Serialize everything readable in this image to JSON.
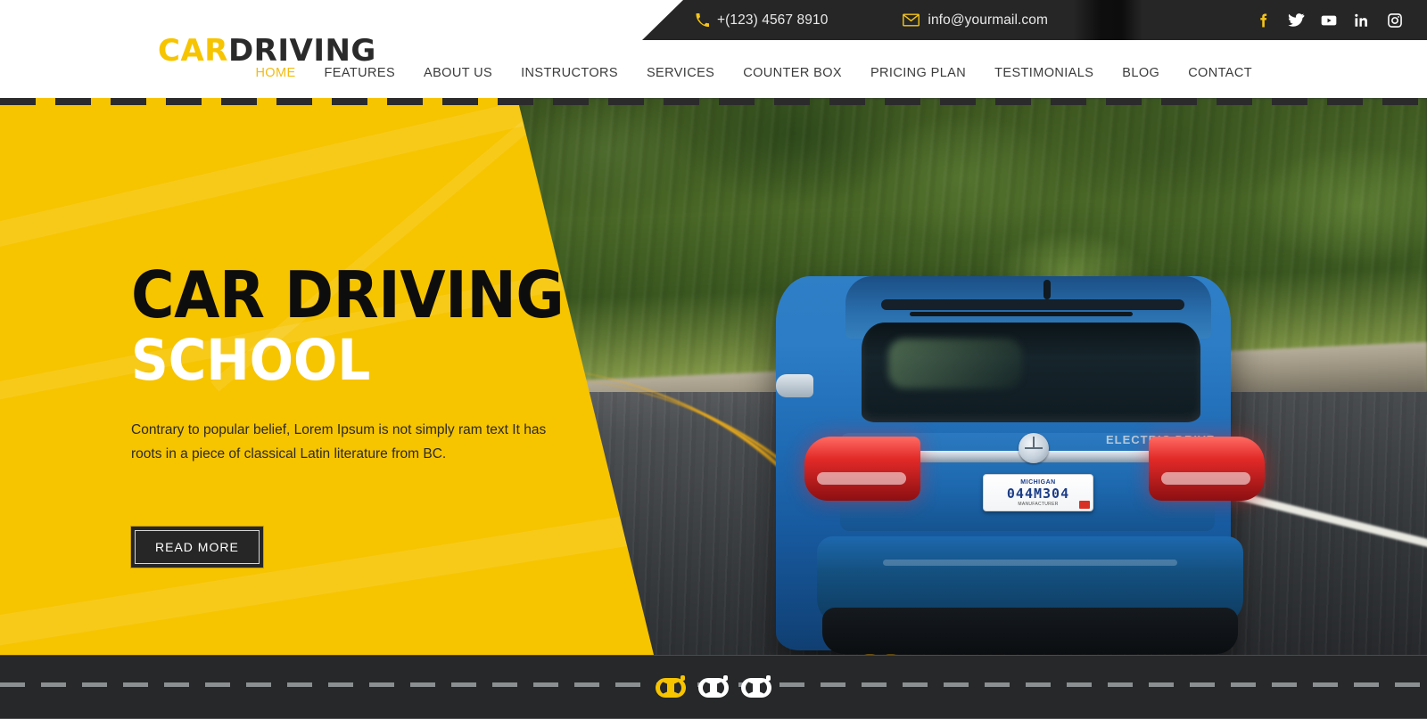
{
  "site": {
    "logo_part1": "CAR",
    "logo_part2": "DRIVING"
  },
  "topbar": {
    "phone": "+(123) 4567 8910",
    "email": "info@yourmail.com",
    "phone_icon": "phone-icon",
    "email_icon": "envelope-icon",
    "socials": [
      {
        "name": "facebook-icon",
        "label": "f"
      },
      {
        "name": "twitter-icon",
        "label": "t"
      },
      {
        "name": "youtube-icon",
        "label": "y"
      },
      {
        "name": "linkedin-icon",
        "label": "in"
      },
      {
        "name": "instagram-icon",
        "label": "ig"
      }
    ]
  },
  "nav": {
    "items": [
      {
        "label": "HOME",
        "active": true
      },
      {
        "label": "FEATURES",
        "active": false
      },
      {
        "label": "ABOUT US",
        "active": false
      },
      {
        "label": "INSTRUCTORS",
        "active": false
      },
      {
        "label": "SERVICES",
        "active": false
      },
      {
        "label": "COUNTER BOX",
        "active": false
      },
      {
        "label": "PRICING PLAN",
        "active": false
      },
      {
        "label": "TESTIMONIALS",
        "active": false
      },
      {
        "label": "BLOG",
        "active": false
      },
      {
        "label": "CONTACT",
        "active": false
      }
    ]
  },
  "hero": {
    "title_line1": "CAR DRIVING",
    "title_line2": "SCHOOL",
    "paragraph": "Contrary to popular belief, Lorem Ipsum is not simply ram text It has roots in a piece of classical Latin literature from BC.",
    "cta_label": "READ MORE",
    "license_plate": {
      "state": "MICHIGAN",
      "number": "044M304",
      "footer": "MANUFACTURER"
    },
    "car_badge": "ELECTRIC DRIVE"
  },
  "carousel": {
    "slides": [
      {
        "index": 1,
        "active": true
      },
      {
        "index": 2,
        "active": false
      },
      {
        "index": 3,
        "active": false
      }
    ]
  },
  "colors": {
    "brand_yellow": "#f7c400",
    "accent_yellow": "#f2bc13",
    "dark": "#262626",
    "road_dark": "#262829",
    "text_dark": "#3b3b3b",
    "white": "#ffffff"
  }
}
